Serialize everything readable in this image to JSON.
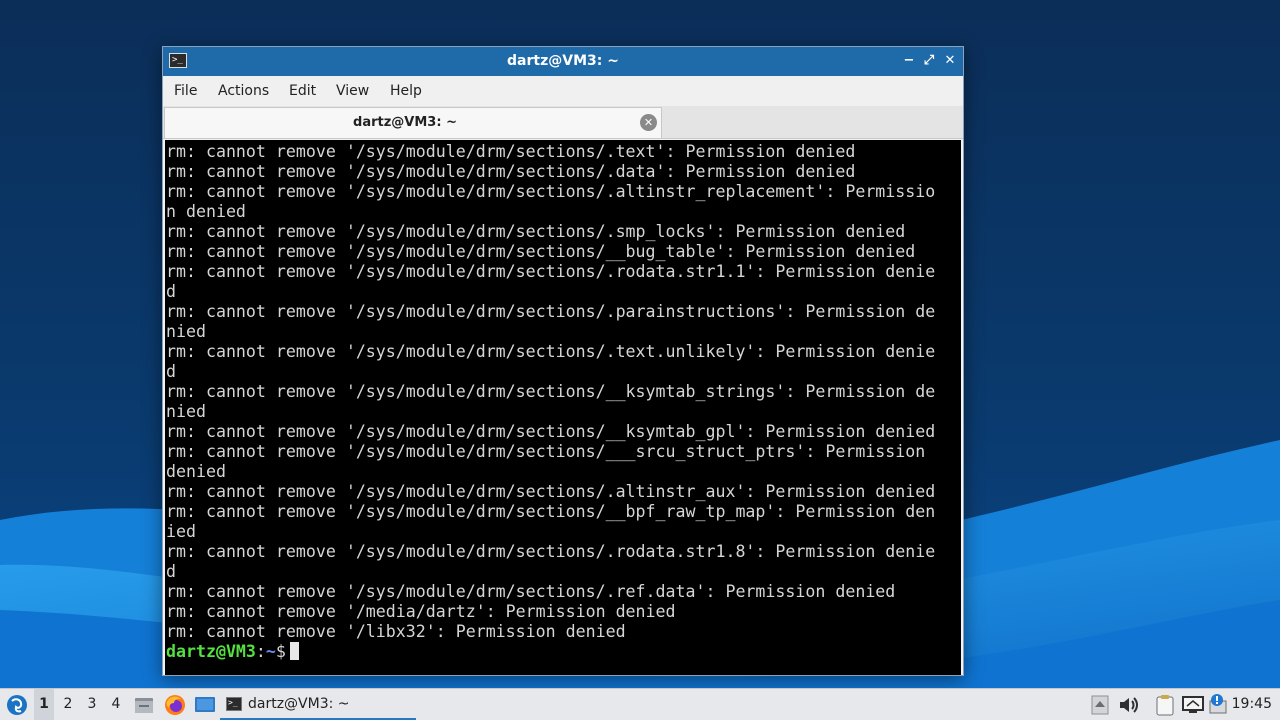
{
  "window": {
    "title": "dartz@VM3: ~",
    "menu": [
      "File",
      "Actions",
      "Edit",
      "View",
      "Help"
    ],
    "tab_label": "dartz@VM3: ~",
    "minimize_glyph": "−",
    "maximize_glyph": "⤢",
    "close_glyph": "✕",
    "tab_close_glyph": "✕",
    "app_icon_glyph": ">_"
  },
  "terminal": {
    "output_lines": [
      "rm: cannot remove '/sys/module/drm/sections/.text': Permission denied",
      "rm: cannot remove '/sys/module/drm/sections/.data': Permission denied",
      "rm: cannot remove '/sys/module/drm/sections/.altinstr_replacement': Permissio",
      "n denied",
      "rm: cannot remove '/sys/module/drm/sections/.smp_locks': Permission denied",
      "rm: cannot remove '/sys/module/drm/sections/__bug_table': Permission denied",
      "rm: cannot remove '/sys/module/drm/sections/.rodata.str1.1': Permission denie",
      "d",
      "rm: cannot remove '/sys/module/drm/sections/.parainstructions': Permission de",
      "nied",
      "rm: cannot remove '/sys/module/drm/sections/.text.unlikely': Permission denie",
      "d",
      "rm: cannot remove '/sys/module/drm/sections/__ksymtab_strings': Permission de",
      "nied",
      "rm: cannot remove '/sys/module/drm/sections/__ksymtab_gpl': Permission denied",
      "rm: cannot remove '/sys/module/drm/sections/___srcu_struct_ptrs': Permission",
      "denied",
      "rm: cannot remove '/sys/module/drm/sections/.altinstr_aux': Permission denied",
      "rm: cannot remove '/sys/module/drm/sections/__bpf_raw_tp_map': Permission den",
      "ied",
      "rm: cannot remove '/sys/module/drm/sections/.rodata.str1.8': Permission denie",
      "d",
      "rm: cannot remove '/sys/module/drm/sections/.ref.data': Permission denied",
      "rm: cannot remove '/media/dartz': Permission denied",
      "rm: cannot remove '/libx32': Permission denied"
    ],
    "prompt_user": "dartz@VM3",
    "prompt_colon": ":",
    "prompt_path": "~",
    "prompt_symbol": "$"
  },
  "taskbar": {
    "workspaces": [
      "1",
      "2",
      "3",
      "4"
    ],
    "active_workspace": "1",
    "task_label": "dartz@VM3: ~",
    "clock": "19:45",
    "icons": [
      "start-menu-icon",
      "file-manager-icon",
      "firefox-icon",
      "desktop-icon",
      "terminal-icon",
      "tray-up-icon",
      "volume-icon",
      "clipboard-icon",
      "network-icon",
      "notification-icon"
    ]
  },
  "colors": {
    "desktop_top": "#0a3566",
    "desktop_wave": "#1d8fe6",
    "titlebar": "#1f6aa8",
    "terminal_bg": "#000000",
    "terminal_fg": "#d6d6d6",
    "prompt_user": "#54e040",
    "prompt_path": "#6b8cf5"
  }
}
